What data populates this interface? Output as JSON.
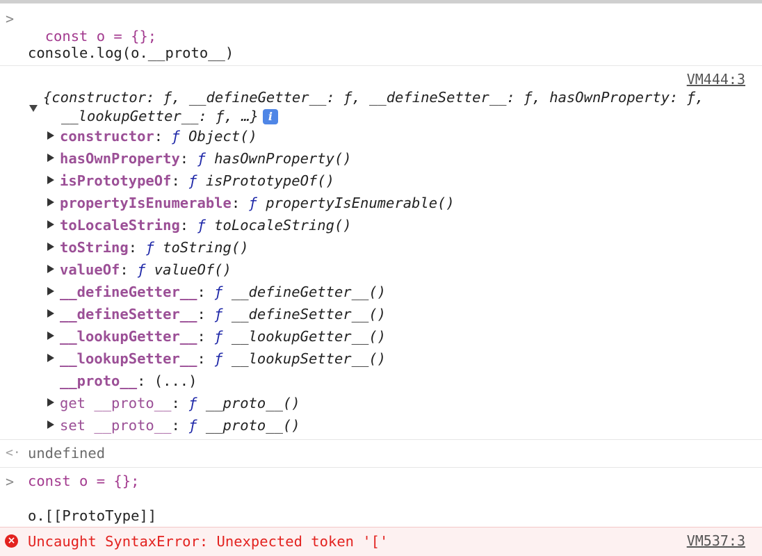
{
  "entries": [
    {
      "input_lines": [
        "const o = {};",
        "console.log(o.__proto__)"
      ],
      "source_link": "VM444:3",
      "summary": {
        "line1_keys": [
          "constructor",
          "__defineGetter__",
          "__defineSetter__",
          "hasOwnProperty"
        ],
        "line2_keys": [
          "__lookupGetter__"
        ],
        "fn_glyph": "ƒ",
        "ellipsis": "…",
        "info_badge": "i"
      },
      "properties": [
        {
          "key": "constructor",
          "value": "Object()",
          "expandable": true
        },
        {
          "key": "hasOwnProperty",
          "value": "hasOwnProperty()",
          "expandable": true
        },
        {
          "key": "isPrototypeOf",
          "value": "isPrototypeOf()",
          "expandable": true
        },
        {
          "key": "propertyIsEnumerable",
          "value": "propertyIsEnumerable()",
          "expandable": true
        },
        {
          "key": "toLocaleString",
          "value": "toLocaleString()",
          "expandable": true
        },
        {
          "key": "toString",
          "value": "toString()",
          "expandable": true
        },
        {
          "key": "valueOf",
          "value": "valueOf()",
          "expandable": true
        },
        {
          "key": "__defineGetter__",
          "value": "__defineGetter__()",
          "expandable": true
        },
        {
          "key": "__defineSetter__",
          "value": "__defineSetter__()",
          "expandable": true
        },
        {
          "key": "__lookupGetter__",
          "value": "__lookupGetter__()",
          "expandable": true
        },
        {
          "key": "__lookupSetter__",
          "value": "__lookupSetter__()",
          "expandable": true
        }
      ],
      "proto_row": {
        "key": "__proto__",
        "value": "(...)"
      },
      "accessors": [
        {
          "key": "get __proto__",
          "value": "__proto__()"
        },
        {
          "key": "set __proto__",
          "value": "__proto__()"
        }
      ],
      "result": "undefined"
    },
    {
      "input_lines": [
        "const o = {};",
        "o.[[ProtoType]]"
      ],
      "error": "Uncaught SyntaxError: Unexpected token '['",
      "source_link": "VM537:3"
    }
  ],
  "colors": {
    "keyword": "#a33b8f",
    "property": "#9b4f96",
    "function_keyword": "#1f28a8",
    "error": "#e3221f",
    "info_badge": "#4f86e6"
  }
}
